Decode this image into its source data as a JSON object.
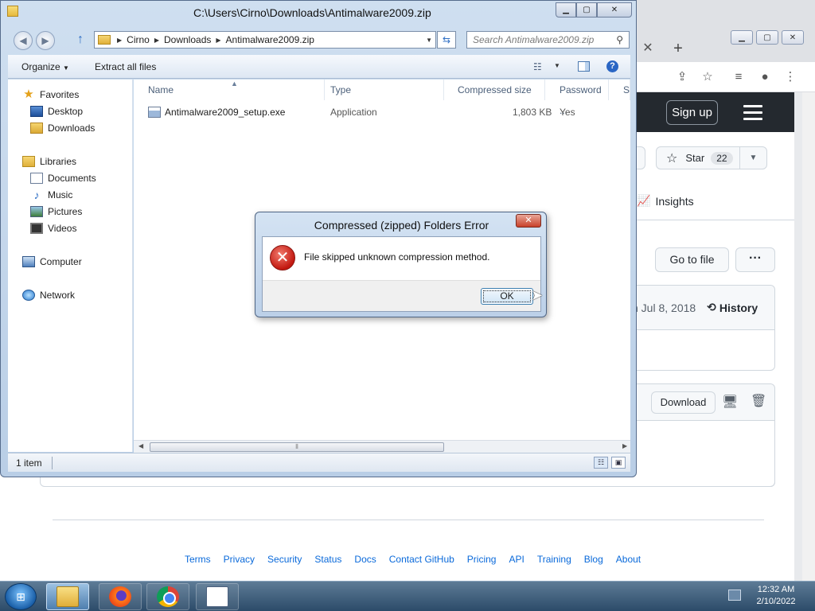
{
  "explorer": {
    "title": "C:\\Users\\Cirno\\Downloads\\Antimalware2009.zip",
    "breadcrumbs": [
      "Cirno",
      "Downloads",
      "Antimalware2009.zip"
    ],
    "search_placeholder": "Search Antimalware2009.zip",
    "toolbar": {
      "organize": "Organize",
      "extract": "Extract all files"
    },
    "nav": {
      "favorites": "Favorites",
      "desktop": "Desktop",
      "downloads": "Downloads",
      "libraries": "Libraries",
      "documents": "Documents",
      "music": "Music",
      "pictures": "Pictures",
      "videos": "Videos",
      "computer": "Computer",
      "network": "Network"
    },
    "columns": {
      "name": "Name",
      "type": "Type",
      "compressed": "Compressed size",
      "password": "Password ...",
      "size": "Si"
    },
    "files": [
      {
        "name": "Antimalware2009_setup.exe",
        "type": "Application",
        "compressed": "1,803 KB",
        "password": "Yes"
      }
    ],
    "status": "1 item"
  },
  "dialog": {
    "title": "Compressed (zipped) Folders Error",
    "message": "File skipped unknown compression method.",
    "ok": "OK"
  },
  "browser": {
    "signup": "Sign up",
    "star_label": "Star",
    "star_count": "22",
    "insights": "Insights",
    "go_to_file": "Go to file",
    "more": "···",
    "commit_date": "n Jul 8, 2018",
    "history": "History",
    "download": "Download",
    "footer_links": [
      "Terms",
      "Privacy",
      "Security",
      "Status",
      "Docs",
      "Contact GitHub",
      "Pricing",
      "API",
      "Training",
      "Blog",
      "About"
    ]
  },
  "taskbar": {
    "time": "12:32 AM",
    "date": "2/10/2022"
  },
  "colors": {
    "accent": "#2f6fc4",
    "error_red": "#c21810",
    "github_dark": "#24292f",
    "link_blue": "#0969da"
  }
}
